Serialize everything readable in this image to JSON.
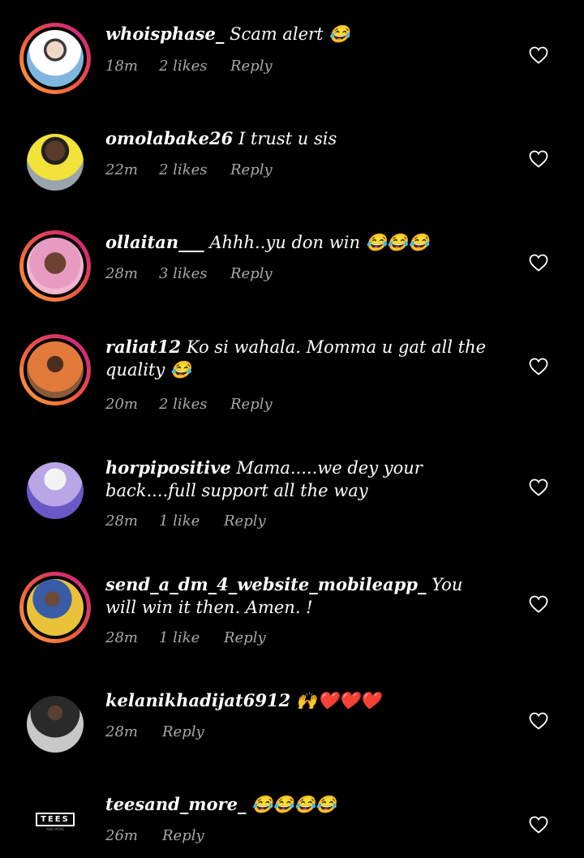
{
  "comments": [
    {
      "username": "whoisphase_",
      "text": "Scam alert 😂",
      "time": "18m",
      "likes": "2 likes",
      "reply": "Reply",
      "story": true,
      "avatar_color": "#6aa7d6"
    },
    {
      "username": "omolabake26",
      "text": "I trust u sis",
      "time": "22m",
      "likes": "2 likes",
      "reply": "Reply",
      "story": false,
      "avatar_color": "#e8e23a"
    },
    {
      "username": "ollaitan___",
      "text": "Ahhh..yu don win 😂😂😂",
      "time": "28m",
      "likes": "3 likes",
      "reply": "Reply",
      "story": true,
      "avatar_color": "#d98fb5"
    },
    {
      "username": "raliat12",
      "text": "Ko si wahala.  Momma u gat all the quality 😂",
      "time": "20m",
      "likes": "2 likes",
      "reply": "Reply",
      "story": true,
      "avatar_color": "#c9713a"
    },
    {
      "username": "horpipositive",
      "text": "Mama.....we dey your back....full support all the way",
      "time": "28m",
      "likes": "1 like",
      "reply": "Reply",
      "story": false,
      "avatar_color": "#8a7ad6"
    },
    {
      "username": "send_a_dm_4_website_mobileapp_",
      "text": "You will win it then. Amen. !",
      "time": "28m",
      "likes": "1 like",
      "reply": "Reply",
      "story": true,
      "avatar_color": "#d9b33a"
    },
    {
      "username": "kelanikhadijat6912",
      "text": "🙌❤️❤️❤️",
      "time": "28m",
      "likes": "",
      "reply": "Reply",
      "story": false,
      "avatar_color": "#9a9a9a"
    },
    {
      "username": "teesand_more_",
      "text": "😂😂😂😂",
      "time": "26m",
      "likes": "",
      "reply": "Reply",
      "story": false,
      "avatar_color": "#000000"
    }
  ],
  "logo": {
    "brand": "TEES",
    "tagline": "AND MORE"
  },
  "colors": {
    "background": "#000000",
    "meta": "#a8a8a8",
    "story_ring_start": "#f9a63c",
    "story_ring_end": "#c12a8d"
  },
  "icons": {
    "like": "heart-outline-icon"
  }
}
